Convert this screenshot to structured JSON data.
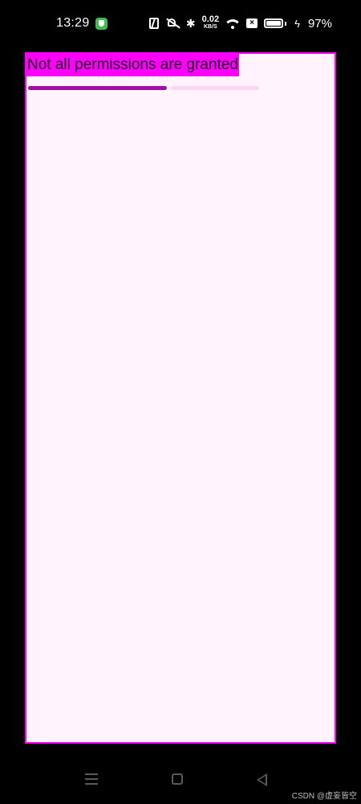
{
  "status_bar": {
    "time": "13:29",
    "net_speed_value": "0.02",
    "net_speed_unit": "KB/S",
    "sim_label": "×",
    "battery_percent_text": "97%",
    "battery_level": 0.97,
    "icons": [
      "app-shield-icon",
      "nfc-icon",
      "mute-icon",
      "bluetooth-icon",
      "wifi-icon",
      "sim-icon",
      "battery-icon",
      "charging-bolt-icon"
    ]
  },
  "app": {
    "banner_text": "Not all permissions are granted",
    "progress_fraction": 0.6,
    "colors": {
      "frame_border": "#ff00ff",
      "background": "#fff4fe",
      "banner_bg": "#ff00ff",
      "progress_fill": "#a10fa3",
      "progress_track": "#ffd6f0"
    }
  },
  "nav_bar": {
    "icons": [
      "menu-icon",
      "home-icon",
      "back-icon"
    ]
  },
  "watermark": "CSDN @虚妄皆空"
}
